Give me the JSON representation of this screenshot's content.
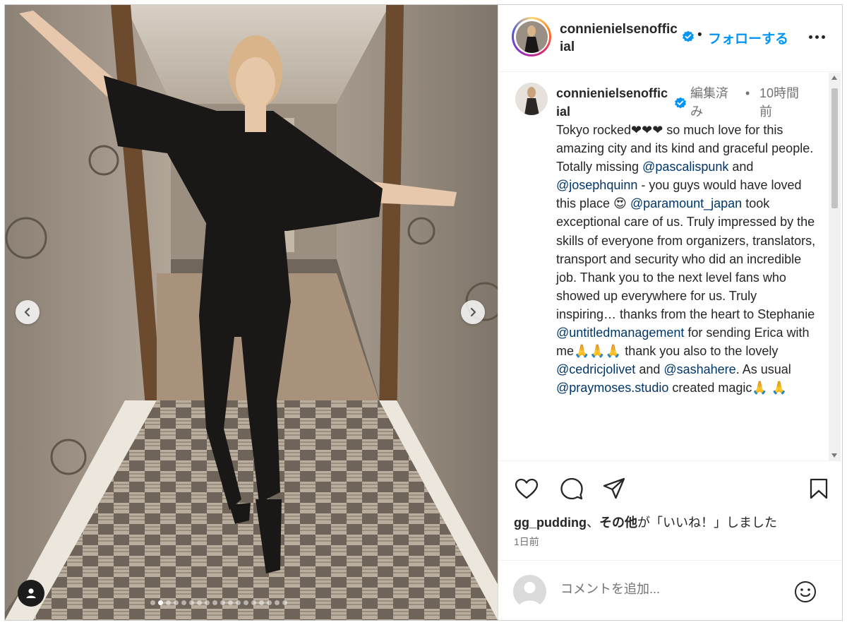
{
  "post": {
    "username": "connienielsenofficial",
    "verified": true,
    "separator": "•",
    "follow_label": "フォローする",
    "more_icon": "more-horizontal-icon",
    "media": {
      "slide_count": 18,
      "active_slide": 2,
      "prev_icon": "chevron-left-icon",
      "next_icon": "chevron-right-icon",
      "tag_icon": "user-tag-icon"
    }
  },
  "comment": {
    "username": "connienielsenofficial",
    "edited": "編集済み",
    "bullet": "•",
    "time": "10時間前",
    "caption": [
      {
        "t": "Tokyo rocked❤❤❤ so much love for this amazing city and its kind and graceful people. Totally missing "
      },
      {
        "t": "@pascalispunk",
        "m": true
      },
      {
        "t": " and "
      },
      {
        "t": "@josephquinn",
        "m": true
      },
      {
        "t": " - you guys would have loved this place 😍 "
      },
      {
        "t": "@paramount_japan",
        "m": true
      },
      {
        "t": " took exceptional care of us. Truly impressed by the skills of everyone from organizers, translators, transport and security who did an incredible job. Thank you to the next level fans who showed up everywhere for us. Truly inspiring… thanks from the heart to Stephanie "
      },
      {
        "t": "@untitledmanagement",
        "m": true
      },
      {
        "t": " for sending Erica with me🙏🙏🙏 thank you also to the lovely "
      },
      {
        "t": "@cedricjolivet",
        "m": true
      },
      {
        "t": " and "
      },
      {
        "t": "@sashahere",
        "m": true
      },
      {
        "t": ". As usual "
      },
      {
        "t": "@praymoses.studio",
        "m": true
      },
      {
        "t": " created magic🙏 🙏"
      }
    ]
  },
  "actions": {
    "icons": [
      "heart-icon",
      "comment-icon",
      "share-icon",
      "bookmark-icon"
    ],
    "liked_by_user": "gg_pudding",
    "liked_sep": "、",
    "liked_others": "その他",
    "liked_suffix": "が「いいね！」しました",
    "date": "1日前"
  },
  "add_comment": {
    "placeholder": "コメントを追加...",
    "emoji_icon": "emoji-icon"
  },
  "colors": {
    "accent": "#0095f6",
    "mention": "#00376b",
    "text": "#262626",
    "muted": "#737373",
    "verified": "#0095f6"
  }
}
